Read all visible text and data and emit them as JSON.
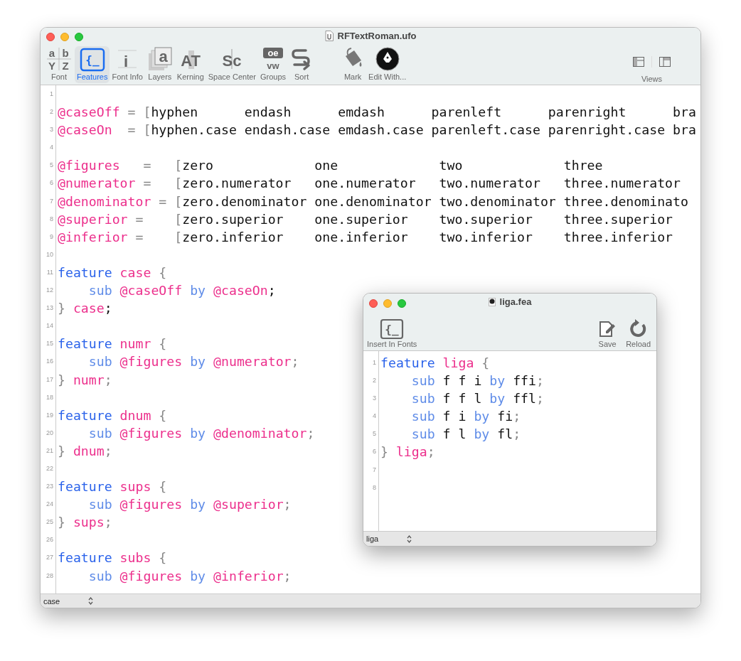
{
  "window": {
    "title": "RFTextRoman.ufo"
  },
  "toolbar": {
    "tools": [
      {
        "label": "Font",
        "selected": false,
        "glyphs": [
          "a",
          "b",
          "Y",
          "Z"
        ]
      },
      {
        "label": "Features",
        "selected": true,
        "glyphs": [
          "{_"
        ]
      },
      {
        "label": "Font Info",
        "selected": false,
        "glyphs": [
          "i"
        ]
      },
      {
        "label": "Layers",
        "selected": false,
        "glyphs": [
          "a"
        ]
      },
      {
        "label": "Kerning",
        "selected": false,
        "glyphs": [
          "AT"
        ]
      },
      {
        "label": "Space Center",
        "selected": false,
        "glyphs": [
          "Sc"
        ]
      },
      {
        "label": "Groups",
        "selected": false,
        "glyphs": [
          "oe",
          "vw"
        ]
      },
      {
        "label": "Sort",
        "selected": false
      }
    ],
    "actions": [
      {
        "label": "Mark"
      },
      {
        "label": "Edit With..."
      }
    ],
    "views": {
      "label": "Views"
    }
  },
  "editor": {
    "lines": [
      {
        "number": "1"
      },
      {
        "number": "2",
        "tokens": [
          {
            "kind": "name",
            "text": "@caseOff"
          },
          {
            "kind": "punct",
            "text": " = ["
          },
          {
            "kind": "text",
            "text": "hyphen      endash      emdash      parenleft      parenright      bra"
          }
        ]
      },
      {
        "number": "3",
        "tokens": [
          {
            "kind": "name",
            "text": "@caseOn"
          },
          {
            "kind": "punct",
            "text": "  = ["
          },
          {
            "kind": "text",
            "text": "hyphen.case endash.case emdash.case parenleft.case parenright.case bra"
          }
        ]
      },
      {
        "number": "4"
      },
      {
        "number": "5",
        "tokens": [
          {
            "kind": "name",
            "text": "@figures"
          },
          {
            "kind": "punct",
            "text": "   =   ["
          },
          {
            "kind": "text",
            "text": "zero             one             two             three"
          }
        ]
      },
      {
        "number": "6",
        "tokens": [
          {
            "kind": "name",
            "text": "@numerator"
          },
          {
            "kind": "punct",
            "text": " =   ["
          },
          {
            "kind": "text",
            "text": "zero.numerator   one.numerator   two.numerator   three.numerator"
          }
        ]
      },
      {
        "number": "7",
        "tokens": [
          {
            "kind": "name",
            "text": "@denominator"
          },
          {
            "kind": "punct",
            "text": " = ["
          },
          {
            "kind": "text",
            "text": "zero.denominator one.denominator two.denominator three.denominato"
          }
        ]
      },
      {
        "number": "8",
        "tokens": [
          {
            "kind": "name",
            "text": "@superior"
          },
          {
            "kind": "punct",
            "text": " =    ["
          },
          {
            "kind": "text",
            "text": "zero.superior    one.superior    two.superior    three.superior"
          }
        ]
      },
      {
        "number": "9",
        "tokens": [
          {
            "kind": "name",
            "text": "@inferior"
          },
          {
            "kind": "punct",
            "text": " =    ["
          },
          {
            "kind": "text",
            "text": "zero.inferior    one.inferior    two.inferior    three.inferior"
          }
        ]
      },
      {
        "number": "10"
      },
      {
        "number": "11",
        "tokens": [
          {
            "kind": "keyword",
            "text": "feature"
          },
          {
            "kind": "name",
            "text": " case"
          },
          {
            "kind": "punct",
            "text": " {"
          }
        ]
      },
      {
        "number": "12",
        "tokens": [
          {
            "kind": "operator",
            "text": "    sub"
          },
          {
            "kind": "name",
            "text": " @caseOff"
          },
          {
            "kind": "operator",
            "text": " by"
          },
          {
            "kind": "name",
            "text": " @caseOn"
          },
          {
            "kind": "text",
            "text": ";"
          }
        ]
      },
      {
        "number": "13",
        "tokens": [
          {
            "kind": "punct",
            "text": "}"
          },
          {
            "kind": "name",
            "text": " case"
          },
          {
            "kind": "text",
            "text": ";"
          }
        ]
      },
      {
        "number": "14"
      },
      {
        "number": "15",
        "tokens": [
          {
            "kind": "keyword",
            "text": "feature"
          },
          {
            "kind": "name",
            "text": " numr"
          },
          {
            "kind": "punct",
            "text": " {"
          }
        ]
      },
      {
        "number": "16",
        "tokens": [
          {
            "kind": "operator",
            "text": "    sub"
          },
          {
            "kind": "name",
            "text": " @figures"
          },
          {
            "kind": "operator",
            "text": " by"
          },
          {
            "kind": "name",
            "text": " @numerator"
          },
          {
            "kind": "punct",
            "text": ";"
          }
        ]
      },
      {
        "number": "17",
        "tokens": [
          {
            "kind": "punct",
            "text": "}"
          },
          {
            "kind": "name",
            "text": " numr"
          },
          {
            "kind": "punct",
            "text": ";"
          }
        ]
      },
      {
        "number": "18"
      },
      {
        "number": "19",
        "tokens": [
          {
            "kind": "keyword",
            "text": "feature"
          },
          {
            "kind": "name",
            "text": " dnum"
          },
          {
            "kind": "punct",
            "text": " {"
          }
        ]
      },
      {
        "number": "20",
        "tokens": [
          {
            "kind": "operator",
            "text": "    sub"
          },
          {
            "kind": "name",
            "text": " @figures"
          },
          {
            "kind": "operator",
            "text": " by"
          },
          {
            "kind": "name",
            "text": " @denominator"
          },
          {
            "kind": "punct",
            "text": ";"
          }
        ]
      },
      {
        "number": "21",
        "tokens": [
          {
            "kind": "punct",
            "text": "}"
          },
          {
            "kind": "name",
            "text": " dnum"
          },
          {
            "kind": "punct",
            "text": ";"
          }
        ]
      },
      {
        "number": "22"
      },
      {
        "number": "23",
        "tokens": [
          {
            "kind": "keyword",
            "text": "feature"
          },
          {
            "kind": "name",
            "text": " sups"
          },
          {
            "kind": "punct",
            "text": " {"
          }
        ]
      },
      {
        "number": "24",
        "tokens": [
          {
            "kind": "operator",
            "text": "    sub"
          },
          {
            "kind": "name",
            "text": " @figures"
          },
          {
            "kind": "operator",
            "text": " by"
          },
          {
            "kind": "name",
            "text": " @superior"
          },
          {
            "kind": "punct",
            "text": ";"
          }
        ]
      },
      {
        "number": "25",
        "tokens": [
          {
            "kind": "punct",
            "text": "}"
          },
          {
            "kind": "name",
            "text": " sups"
          },
          {
            "kind": "punct",
            "text": ";"
          }
        ]
      },
      {
        "number": "26"
      },
      {
        "number": "27",
        "tokens": [
          {
            "kind": "keyword",
            "text": "feature"
          },
          {
            "kind": "name",
            "text": " subs"
          },
          {
            "kind": "punct",
            "text": " {"
          }
        ]
      },
      {
        "number": "28",
        "tokens": [
          {
            "kind": "operator",
            "text": "    sub"
          },
          {
            "kind": "name",
            "text": " @figures"
          },
          {
            "kind": "operator",
            "text": " by"
          },
          {
            "kind": "name",
            "text": " @inferior"
          },
          {
            "kind": "punct",
            "text": ";"
          }
        ]
      }
    ]
  },
  "status_bar": {
    "feature_popup": "case"
  },
  "liga_window": {
    "title": "liga.fea",
    "toolbar": {
      "insert": {
        "label": "Insert In Fonts",
        "glyphs": [
          "{_"
        ]
      },
      "actions": [
        {
          "label": "Save"
        },
        {
          "label": "Reload"
        }
      ]
    },
    "lines": [
      {
        "number": "1",
        "tokens": [
          {
            "kind": "keyword",
            "text": "feature"
          },
          {
            "kind": "name",
            "text": " liga"
          },
          {
            "kind": "punct",
            "text": " {"
          }
        ]
      },
      {
        "number": "2",
        "tokens": [
          {
            "kind": "operator",
            "text": "    sub"
          },
          {
            "kind": "text",
            "text": " f f i"
          },
          {
            "kind": "operator",
            "text": " by"
          },
          {
            "kind": "text",
            "text": " ffi"
          },
          {
            "kind": "punct",
            "text": ";"
          }
        ]
      },
      {
        "number": "3",
        "tokens": [
          {
            "kind": "operator",
            "text": "    sub"
          },
          {
            "kind": "text",
            "text": " f f l"
          },
          {
            "kind": "operator",
            "text": " by"
          },
          {
            "kind": "text",
            "text": " ffl"
          },
          {
            "kind": "punct",
            "text": ";"
          }
        ]
      },
      {
        "number": "4",
        "tokens": [
          {
            "kind": "operator",
            "text": "    sub"
          },
          {
            "kind": "text",
            "text": " f i"
          },
          {
            "kind": "operator",
            "text": " by"
          },
          {
            "kind": "text",
            "text": " fi"
          },
          {
            "kind": "punct",
            "text": ";"
          }
        ]
      },
      {
        "number": "5",
        "tokens": [
          {
            "kind": "operator",
            "text": "    sub"
          },
          {
            "kind": "text",
            "text": " f l"
          },
          {
            "kind": "operator",
            "text": " by"
          },
          {
            "kind": "text",
            "text": " fl"
          },
          {
            "kind": "punct",
            "text": ";"
          }
        ]
      },
      {
        "number": "6",
        "tokens": [
          {
            "kind": "punct",
            "text": "}"
          },
          {
            "kind": "name",
            "text": " liga"
          },
          {
            "kind": "punct",
            "text": ";"
          }
        ]
      },
      {
        "number": "7"
      },
      {
        "number": "8"
      }
    ],
    "status_bar": {
      "feature_popup": "liga"
    }
  }
}
